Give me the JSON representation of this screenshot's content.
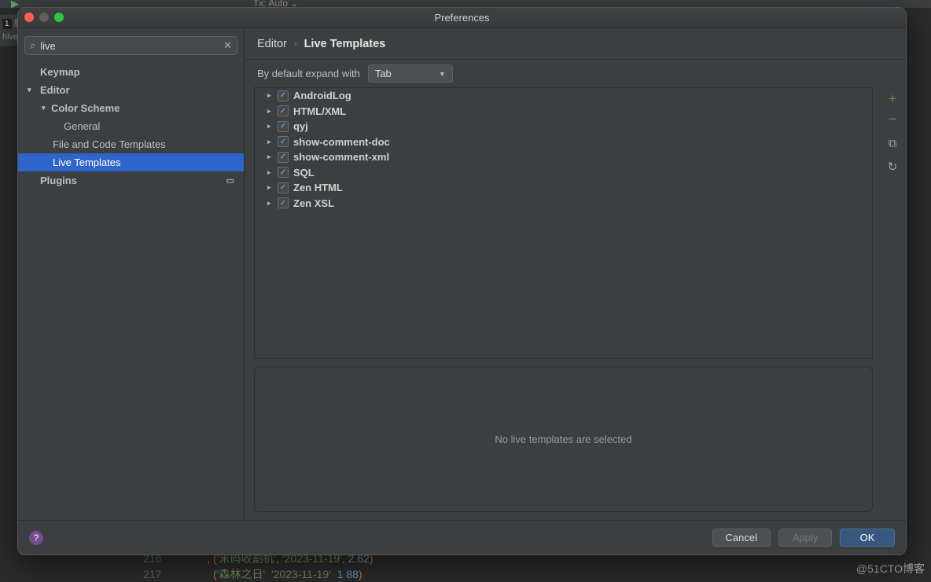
{
  "toolbar": {
    "tx_label": "Tx: Auto ⌄"
  },
  "left_tabs": {
    "server_label": "服务器",
    "badge": "1",
    "hive_label": "hive"
  },
  "code": {
    "line1_num": "216",
    "line1_text": ", ('米码收割机', '2023-11-19', 2.62)",
    "line2_num": "217",
    "line2_text": "  ('森林之日' '2023-11-19'  1 88)"
  },
  "watermark": "@51CTO博客",
  "window": {
    "title": "Preferences"
  },
  "search": {
    "value": "live",
    "placeholder": ""
  },
  "tree": {
    "keymap": "Keymap",
    "editor": "Editor",
    "color_scheme": "Color Scheme",
    "general": "General",
    "file_code_tpl": "File and Code Templates",
    "live_templates": "Live Templates",
    "plugins": "Plugins"
  },
  "breadcrumb": {
    "root": "Editor",
    "current": "Live Templates"
  },
  "expand": {
    "label": "By default expand with",
    "value": "Tab"
  },
  "groups": [
    {
      "name": "AndroidLog"
    },
    {
      "name": "HTML/XML"
    },
    {
      "name": "qyj"
    },
    {
      "name": "show-comment-doc"
    },
    {
      "name": "show-comment-xml"
    },
    {
      "name": "SQL"
    },
    {
      "name": "Zen HTML"
    },
    {
      "name": "Zen XSL"
    }
  ],
  "preview_empty": "No live templates are selected",
  "buttons": {
    "cancel": "Cancel",
    "apply": "Apply",
    "ok": "OK",
    "help": "?"
  }
}
